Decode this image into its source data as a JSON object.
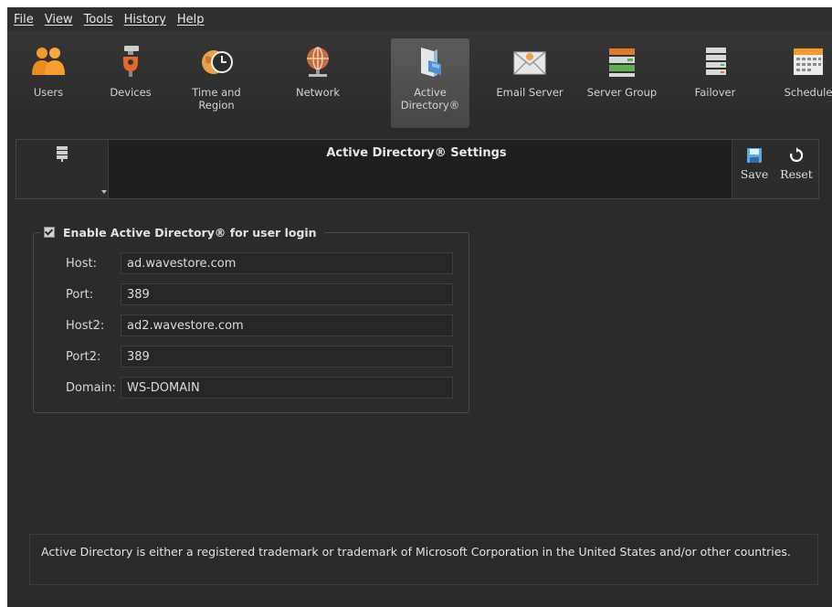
{
  "menu": {
    "items": [
      "File",
      "View",
      "Tools",
      "History",
      "Help"
    ]
  },
  "toolbar": {
    "items": [
      {
        "label": "Users",
        "icon": "users-icon"
      },
      {
        "label": "Devices",
        "icon": "devices-icon"
      },
      {
        "label": "Time and\nRegion",
        "icon": "time-region-icon"
      },
      {
        "label": "Network",
        "icon": "network-icon"
      },
      {
        "label": "Active\nDirectory®",
        "icon": "active-directory-icon",
        "active": true
      },
      {
        "label": "Email Server",
        "icon": "email-icon"
      },
      {
        "label": "Server Group",
        "icon": "server-group-icon"
      },
      {
        "label": "Failover",
        "icon": "failover-icon"
      },
      {
        "label": "Schedule",
        "icon": "schedule-icon"
      }
    ]
  },
  "header": {
    "title": "Active Directory® Settings",
    "save_label": "Save",
    "reset_label": "Reset"
  },
  "ad": {
    "enable_label": "Enable Active Directory® for user login",
    "enabled": true,
    "fields": [
      {
        "label": "Host:",
        "value": "ad.wavestore.com"
      },
      {
        "label": "Port:",
        "value": "389"
      },
      {
        "label": "Host2:",
        "value": "ad2.wavestore.com"
      },
      {
        "label": "Port2:",
        "value": "389"
      },
      {
        "label": "Domain:",
        "value": "WS-DOMAIN"
      }
    ]
  },
  "note": "Active Directory is either a registered trademark or trademark of Microsoft Corporation in the United States and/or other countries.",
  "colors": {
    "background": "#2b2b2b",
    "users_orange": "#f39a2a",
    "save_blue": "#5aa8e6"
  }
}
